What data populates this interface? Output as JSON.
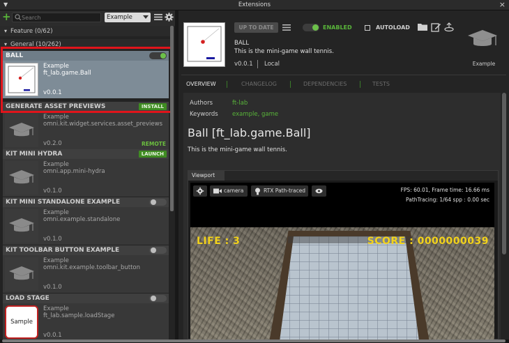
{
  "window": {
    "title": "Extensions"
  },
  "toolbar": {
    "search_placeholder": "Search",
    "filter_value": "Example"
  },
  "groups": [
    {
      "label": "Feature (0/62)"
    },
    {
      "label": "General (10/262)"
    }
  ],
  "extensions": [
    {
      "name": "BALL",
      "vendor": "Example",
      "id": "ft_lab.game.Ball",
      "version": "v0.0.1",
      "state": "enabled"
    },
    {
      "name": "GENERATE ASSET PREVIEWS",
      "vendor": "Example",
      "id": "omni.kit.widget.services.asset_previews",
      "version": "v0.2.0",
      "badge": "INSTALL",
      "remote": "REMOTE"
    },
    {
      "name": "KIT MINI HYDRA",
      "vendor": "Example",
      "id": "omni.app.mini-hydra",
      "version": "v0.1.0",
      "badge": "LAUNCH"
    },
    {
      "name": "KIT MINI STANDALONE EXAMPLE",
      "vendor": "Example",
      "id": "omni.example.standalone",
      "version": "v0.1.0",
      "state": "disabled"
    },
    {
      "name": "KIT TOOLBAR BUTTON EXAMPLE",
      "vendor": "Example",
      "id": "omni.kit.example.toolbar_button",
      "version": "v0.1.0",
      "state": "disabled"
    },
    {
      "name": "LOAD STAGE",
      "vendor": "Example",
      "id": "ft_lab.sample.loadStage",
      "version": "v0.0.1",
      "state": "disabled",
      "thumb_text": "Sample"
    }
  ],
  "detail": {
    "status_button": "UP TO DATE",
    "enabled_label": "ENABLED",
    "autoload_label": "AUTOLOAD",
    "name": "BALL",
    "description": "This is the mini-game wall tennis.",
    "version": "v0.0.1",
    "location": "Local",
    "vendor": "Example",
    "tabs": [
      "OVERVIEW",
      "CHANGELOG",
      "DEPENDENCIES",
      "TESTS"
    ],
    "authors_key": "Authors",
    "authors_value": "ft-lab",
    "keywords_key": "Keywords",
    "keywords_value": "example, game",
    "doc_title": "Ball [ft_lab.game.Ball]",
    "doc_body": "This is the mini-game wall tennis."
  },
  "viewport": {
    "tab_label": "Viewport",
    "camera_label": "camera",
    "render_label": "RTX Path-traced",
    "stats_line1": "FPS: 60.01, Frame time: 16.66 ms",
    "stats_line2": "PathTracing: 1/64 spp : 0.00 sec",
    "life_text": "LIFE : 3",
    "score_text": "SCORE : 0000000039"
  },
  "colors": {
    "accent_green": "#59b53a",
    "selection_red": "#e0141b",
    "hud_yellow": "#f2d21a"
  }
}
